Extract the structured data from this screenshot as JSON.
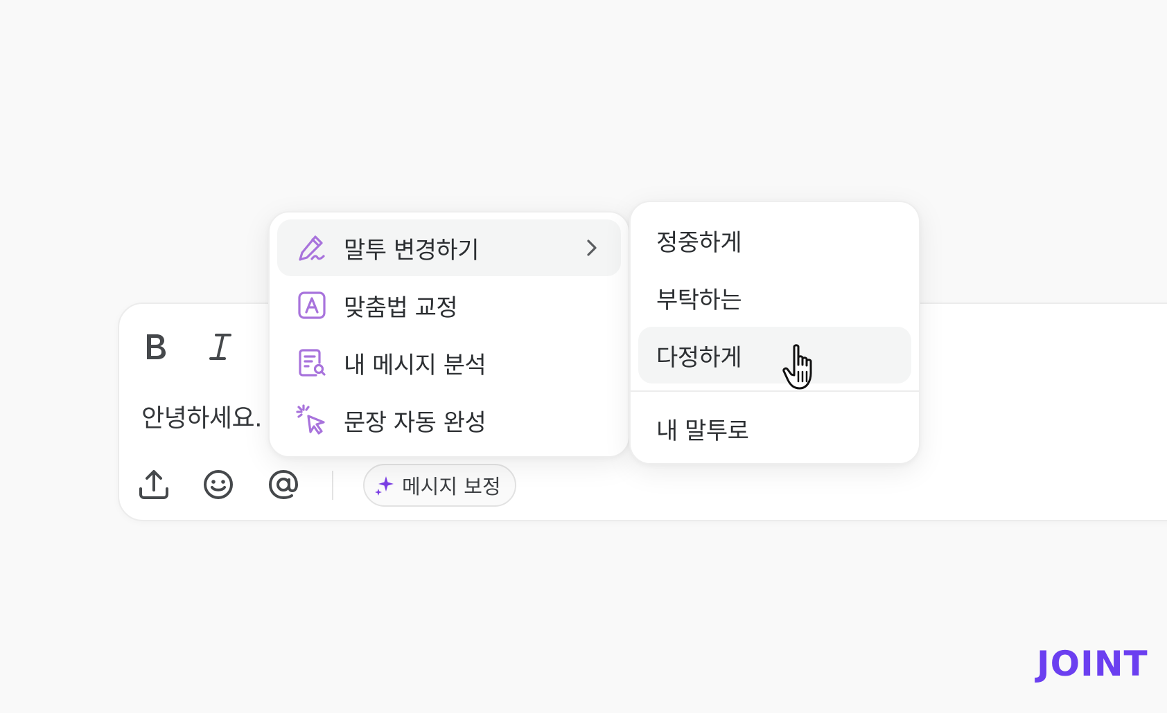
{
  "composer": {
    "message_text": "안녕하세요.",
    "refine_button_label": "메시지 보정"
  },
  "main_menu": {
    "items": [
      {
        "label": "말투 변경하기",
        "icon": "pen-icon",
        "active": true,
        "has_submenu": true
      },
      {
        "label": "맞춤법 교정",
        "icon": "spellcheck-icon"
      },
      {
        "label": "내 메시지 분석",
        "icon": "document-search-icon"
      },
      {
        "label": "문장 자동 완성",
        "icon": "sparkle-cursor-icon"
      }
    ]
  },
  "tone_submenu": {
    "items": [
      {
        "label": "정중하게"
      },
      {
        "label": "부탁하는"
      },
      {
        "label": "다정하게",
        "active": true
      },
      {
        "label": "내 말투로"
      }
    ]
  },
  "brand": {
    "name": "JOINT"
  },
  "colors": {
    "accent": "#7b3fe4",
    "brand": "#6b3ff0",
    "menu_icon": "#a873dc",
    "active_item_bg": "#f4f5f5"
  }
}
